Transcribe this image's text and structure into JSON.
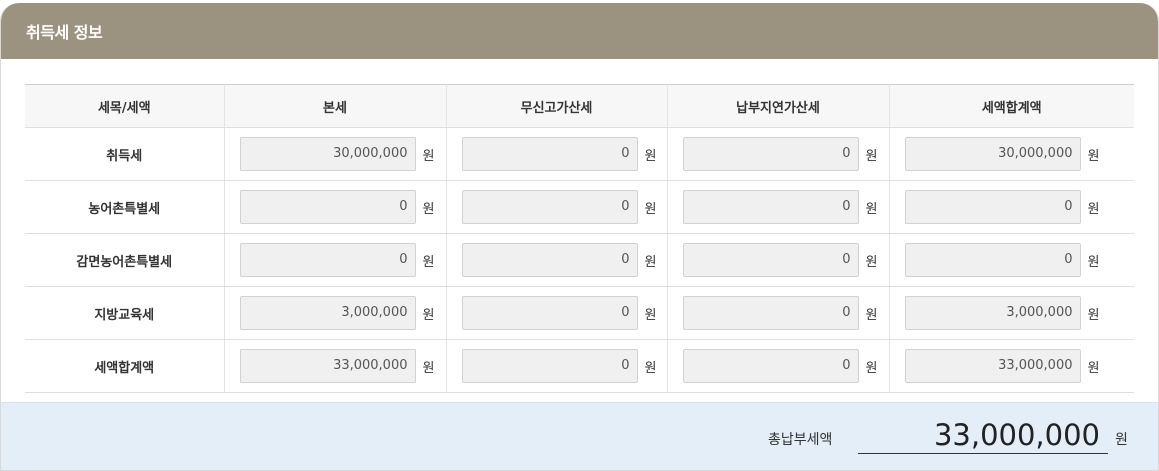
{
  "header": {
    "title": "취득세 정보"
  },
  "table": {
    "columns": [
      "세목/세액",
      "본세",
      "무신고가산세",
      "납부지연가산세",
      "세액합계액"
    ],
    "unit": "원",
    "rows": [
      {
        "label": "취득세",
        "values": [
          "30,000,000",
          "0",
          "0",
          "30,000,000"
        ]
      },
      {
        "label": "농어촌특별세",
        "values": [
          "0",
          "0",
          "0",
          "0"
        ]
      },
      {
        "label": "감면농어촌특별세",
        "values": [
          "0",
          "0",
          "0",
          "0"
        ]
      },
      {
        "label": "지방교육세",
        "values": [
          "3,000,000",
          "0",
          "0",
          "3,000,000"
        ]
      },
      {
        "label": "세액합계액",
        "values": [
          "33,000,000",
          "0",
          "0",
          "33,000,000"
        ]
      }
    ]
  },
  "total": {
    "label": "총납부세액",
    "value": "33,000,000",
    "unit": "원"
  },
  "colors": {
    "header_bg": "#9c9280",
    "footer_bg": "#e4eef8",
    "input_bg": "#f0f0f0"
  }
}
